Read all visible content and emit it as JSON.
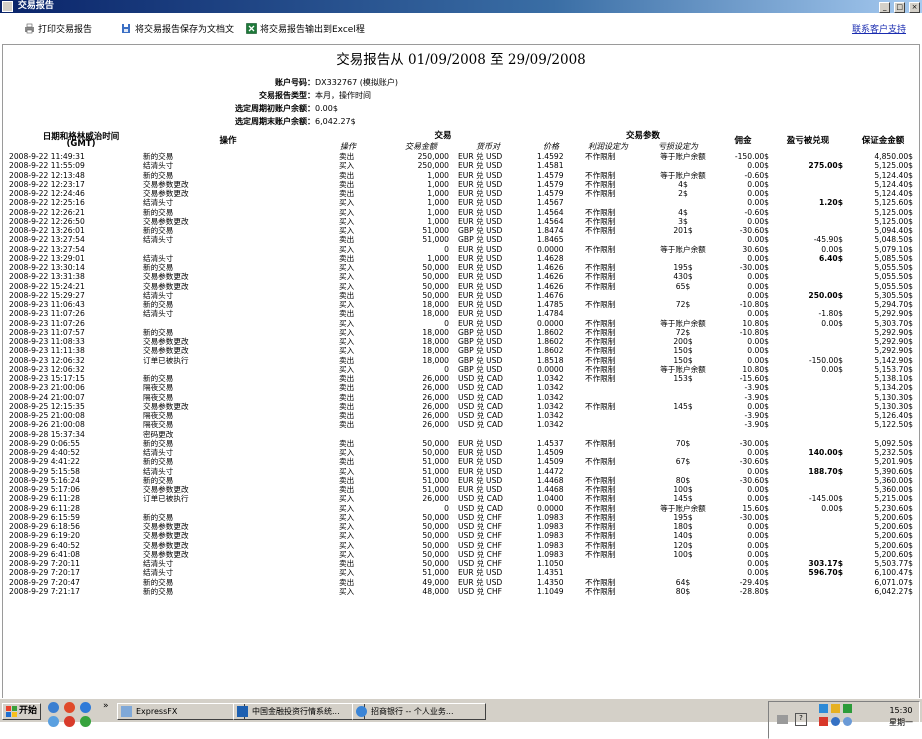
{
  "window": {
    "title": "交易报告",
    "buttons": [
      "_",
      "□",
      "×"
    ]
  },
  "toolbar": {
    "print_label": "打印交易报告",
    "save_label": "将交易报告保存为文档文",
    "excel_label": "将交易报告输出到Excel程",
    "support_link": "联系客户支持"
  },
  "report": {
    "title": "交易报告从 01/09/2008 至 29/09/2008",
    "meta": [
      {
        "label": "账户号码：",
        "value": "DX332767 (模拟账户)"
      },
      {
        "label": "交易报告类型：",
        "value": "本月，操作时间"
      },
      {
        "label": "选定周期初账户余额：",
        "value": "0.00$"
      },
      {
        "label": "选定周期末账户余额：",
        "value": "6,042.27$"
      }
    ],
    "headers": {
      "date": "日期和格林威治时间",
      "date_sub": "(GMT)",
      "operation": "操作",
      "trade": "交易",
      "trade_params": "交易参数",
      "commission": "佣金",
      "pl": "盈亏被兑现",
      "margin": "保证金金额"
    },
    "subheaders": {
      "action": "操作",
      "amount": "交易金额",
      "pair": "货币对",
      "price": "价格",
      "stop": "利润设定为",
      "limit": "亏损设定为"
    },
    "rows": [
      [
        "2008-9-22 11:49:31",
        "新的交易",
        "卖出",
        "250,000",
        "EUR 兑 USD",
        "1.4592",
        "不作限制",
        "等于账户余额",
        "-150.00$",
        "",
        "4,850.00$"
      ],
      [
        "2008-9-22 11:55:09",
        "结清头寸",
        "买入",
        "250,000",
        "EUR 兑 USD",
        "1.4581",
        "",
        "",
        "0.00$",
        "275.00$",
        "5,125.00$"
      ],
      [
        "2008-9-22 12:13:48",
        "新的交易",
        "卖出",
        "1,000",
        "EUR 兑 USD",
        "1.4579",
        "不作限制",
        "等于账户余额",
        "-0.60$",
        "",
        "5,124.40$"
      ],
      [
        "2008-9-22 12:23:17",
        "交易参数更改",
        "卖出",
        "1,000",
        "EUR 兑 USD",
        "1.4579",
        "不作限制",
        "4$",
        "0.00$",
        "",
        "5,124.40$"
      ],
      [
        "2008-9-22 12:24:46",
        "交易参数更改",
        "卖出",
        "1,000",
        "EUR 兑 USD",
        "1.4579",
        "不作限制",
        "2$",
        "0.00$",
        "",
        "5,124.40$"
      ],
      [
        "2008-9-22 12:25:16",
        "结清头寸",
        "买入",
        "1,000",
        "EUR 兑 USD",
        "1.4567",
        "",
        "",
        "0.00$",
        "1.20$",
        "5,125.60$"
      ],
      [
        "2008-9-22 12:26:21",
        "新的交易",
        "买入",
        "1,000",
        "EUR 兑 USD",
        "1.4564",
        "不作限制",
        "4$",
        "-0.60$",
        "",
        "5,125.00$"
      ],
      [
        "2008-9-22 12:26:50",
        "交易参数更改",
        "买入",
        "1,000",
        "EUR 兑 USD",
        "1.4564",
        "不作限制",
        "3$",
        "0.00$",
        "",
        "5,125.00$"
      ],
      [
        "2008-9-22 13:26:01",
        "新的交易",
        "买入",
        "51,000",
        "GBP 兑 USD",
        "1.8474",
        "不作限制",
        "201$",
        "-30.60$",
        "",
        "5,094.40$"
      ],
      [
        "2008-9-22 13:27:54",
        "结清头寸",
        "卖出",
        "51,000",
        "GBP 兑 USD",
        "1.8465",
        "",
        "",
        "0.00$",
        "-45.90$",
        "5,048.50$"
      ],
      [
        "2008-9-22 13:27:54",
        "",
        "买入",
        "0",
        "EUR 兑 USD",
        "0.0000",
        "不作限制",
        "等于账户余额",
        "30.60$",
        "0.00$",
        "5,079.10$"
      ],
      [
        "2008-9-22 13:29:01",
        "结清头寸",
        "卖出",
        "1,000",
        "EUR 兑 USD",
        "1.4628",
        "",
        "",
        "0.00$",
        "6.40$",
        "5,085.50$"
      ],
      [
        "2008-9-22 13:30:14",
        "新的交易",
        "买入",
        "50,000",
        "EUR 兑 USD",
        "1.4626",
        "不作限制",
        "195$",
        "-30.00$",
        "",
        "5,055.50$"
      ],
      [
        "2008-9-22 13:31:38",
        "交易参数更改",
        "买入",
        "50,000",
        "EUR 兑 USD",
        "1.4626",
        "不作限制",
        "430$",
        "0.00$",
        "",
        "5,055.50$"
      ],
      [
        "2008-9-22 15:24:21",
        "交易参数更改",
        "买入",
        "50,000",
        "EUR 兑 USD",
        "1.4626",
        "不作限制",
        "65$",
        "0.00$",
        "",
        "5,055.50$"
      ],
      [
        "2008-9-22 15:29:27",
        "结清头寸",
        "卖出",
        "50,000",
        "EUR 兑 USD",
        "1.4676",
        "",
        "",
        "0.00$",
        "250.00$",
        "5,305.50$"
      ],
      [
        "2008-9-23 11:06:43",
        "新的交易",
        "买入",
        "18,000",
        "EUR 兑 USD",
        "1.4785",
        "不作限制",
        "72$",
        "-10.80$",
        "",
        "5,294.70$"
      ],
      [
        "2008-9-23 11:07:26",
        "结清头寸",
        "卖出",
        "18,000",
        "EUR 兑 USD",
        "1.4784",
        "",
        "",
        "0.00$",
        "-1.80$",
        "5,292.90$"
      ],
      [
        "2008-9-23 11:07:26",
        "",
        "买入",
        "0",
        "EUR 兑 USD",
        "0.0000",
        "不作限制",
        "等于账户余额",
        "10.80$",
        "0.00$",
        "5,303.70$"
      ],
      [
        "2008-9-23 11:07:57",
        "新的交易",
        "买入",
        "18,000",
        "GBP 兑 USD",
        "1.8602",
        "不作限制",
        "72$",
        "-10.80$",
        "",
        "5,292.90$"
      ],
      [
        "2008-9-23 11:08:33",
        "交易参数更改",
        "买入",
        "18,000",
        "GBP 兑 USD",
        "1.8602",
        "不作限制",
        "200$",
        "0.00$",
        "",
        "5,292.90$"
      ],
      [
        "2008-9-23 11:11:38",
        "交易参数更改",
        "买入",
        "18,000",
        "GBP 兑 USD",
        "1.8602",
        "不作限制",
        "150$",
        "0.00$",
        "",
        "5,292.90$"
      ],
      [
        "2008-9-23 12:06:32",
        "订单已被执行",
        "卖出",
        "18,000",
        "GBP 兑 USD",
        "1.8518",
        "不作限制",
        "150$",
        "0.00$",
        "-150.00$",
        "5,142.90$"
      ],
      [
        "2008-9-23 12:06:32",
        "",
        "买入",
        "0",
        "GBP 兑 USD",
        "0.0000",
        "不作限制",
        "等于账户余额",
        "10.80$",
        "0.00$",
        "5,153.70$"
      ],
      [
        "2008-9-23 15:17:15",
        "新的交易",
        "卖出",
        "26,000",
        "USD 兑 CAD",
        "1.0342",
        "不作限制",
        "153$",
        "-15.60$",
        "",
        "5,138.10$"
      ],
      [
        "2008-9-23 21:00:06",
        "隔夜交易",
        "卖出",
        "26,000",
        "USD 兑 CAD",
        "1.0342",
        "",
        "",
        "-3.90$",
        "",
        "5,134.20$"
      ],
      [
        "2008-9-24 21:00:07",
        "隔夜交易",
        "卖出",
        "26,000",
        "USD 兑 CAD",
        "1.0342",
        "",
        "",
        "-3.90$",
        "",
        "5,130.30$"
      ],
      [
        "2008-9-25 12:15:35",
        "交易参数更改",
        "卖出",
        "26,000",
        "USD 兑 CAD",
        "1.0342",
        "不作限制",
        "145$",
        "0.00$",
        "",
        "5,130.30$"
      ],
      [
        "2008-9-25 21:00:08",
        "隔夜交易",
        "卖出",
        "26,000",
        "USD 兑 CAD",
        "1.0342",
        "",
        "",
        "-3.90$",
        "",
        "5,126.40$"
      ],
      [
        "2008-9-26 21:00:08",
        "隔夜交易",
        "卖出",
        "26,000",
        "USD 兑 CAD",
        "1.0342",
        "",
        "",
        "-3.90$",
        "",
        "5,122.50$"
      ],
      [
        "2008-9-28 15:37:34",
        "密码更改",
        "",
        "",
        "",
        "",
        "",
        "",
        "",
        "",
        ""
      ],
      [
        "2008-9-29 0:06:55",
        "新的交易",
        "卖出",
        "50,000",
        "EUR 兑 USD",
        "1.4537",
        "不作限制",
        "70$",
        "-30.00$",
        "",
        "5,092.50$"
      ],
      [
        "2008-9-29 4:40:52",
        "结清头寸",
        "买入",
        "50,000",
        "EUR 兑 USD",
        "1.4509",
        "",
        "",
        "0.00$",
        "140.00$",
        "5,232.50$"
      ],
      [
        "2008-9-29 4:41:22",
        "新的交易",
        "卖出",
        "51,000",
        "EUR 兑 USD",
        "1.4509",
        "不作限制",
        "67$",
        "-30.60$",
        "",
        "5,201.90$"
      ],
      [
        "2008-9-29 5:15:58",
        "结清头寸",
        "买入",
        "51,000",
        "EUR 兑 USD",
        "1.4472",
        "",
        "",
        "0.00$",
        "188.70$",
        "5,390.60$"
      ],
      [
        "2008-9-29 5:16:24",
        "新的交易",
        "卖出",
        "51,000",
        "EUR 兑 USD",
        "1.4468",
        "不作限制",
        "80$",
        "-30.60$",
        "",
        "5,360.00$"
      ],
      [
        "2008-9-29 5:17:06",
        "交易参数更改",
        "卖出",
        "51,000",
        "EUR 兑 USD",
        "1.4468",
        "不作限制",
        "100$",
        "0.00$",
        "",
        "5,360.00$"
      ],
      [
        "2008-9-29 6:11:28",
        "订单已被执行",
        "买入",
        "26,000",
        "USD 兑 CAD",
        "1.0400",
        "不作限制",
        "145$",
        "0.00$",
        "-145.00$",
        "5,215.00$"
      ],
      [
        "2008-9-29 6:11:28",
        "",
        "买入",
        "0",
        "USD 兑 CAD",
        "0.0000",
        "不作限制",
        "等于账户余额",
        "15.60$",
        "0.00$",
        "5,230.60$"
      ],
      [
        "2008-9-29 6:15:59",
        "新的交易",
        "买入",
        "50,000",
        "USD 兑 CHF",
        "1.0983",
        "不作限制",
        "195$",
        "-30.00$",
        "",
        "5,200.60$"
      ],
      [
        "2008-9-29 6:18:56",
        "交易参数更改",
        "买入",
        "50,000",
        "USD 兑 CHF",
        "1.0983",
        "不作限制",
        "180$",
        "0.00$",
        "",
        "5,200.60$"
      ],
      [
        "2008-9-29 6:19:20",
        "交易参数更改",
        "买入",
        "50,000",
        "USD 兑 CHF",
        "1.0983",
        "不作限制",
        "140$",
        "0.00$",
        "",
        "5,200.60$"
      ],
      [
        "2008-9-29 6:40:52",
        "交易参数更改",
        "买入",
        "50,000",
        "USD 兑 CHF",
        "1.0983",
        "不作限制",
        "120$",
        "0.00$",
        "",
        "5,200.60$"
      ],
      [
        "2008-9-29 6:41:08",
        "交易参数更改",
        "买入",
        "50,000",
        "USD 兑 CHF",
        "1.0983",
        "不作限制",
        "100$",
        "0.00$",
        "",
        "5,200.60$"
      ],
      [
        "2008-9-29 7:20:11",
        "结清头寸",
        "卖出",
        "50,000",
        "USD 兑 CHF",
        "1.1050",
        "",
        "",
        "0.00$",
        "303.17$",
        "5,503.77$"
      ],
      [
        "2008-9-29 7:20:17",
        "结清头寸",
        "买入",
        "51,000",
        "EUR 兑 USD",
        "1.4351",
        "",
        "",
        "0.00$",
        "596.70$",
        "6,100.47$"
      ],
      [
        "2008-9-29 7:20:47",
        "新的交易",
        "卖出",
        "49,000",
        "EUR 兑 USD",
        "1.4350",
        "不作限制",
        "64$",
        "-29.40$",
        "",
        "6,071.07$"
      ],
      [
        "2008-9-29 7:21:17",
        "新的交易",
        "买入",
        "48,000",
        "USD 兑 CHF",
        "1.1049",
        "不作限制",
        "80$",
        "-28.80$",
        "",
        "6,042.27$"
      ]
    ],
    "bold_pl": [
      "275.00$",
      "1.20$",
      "6.40$",
      "250.00$",
      "140.00$",
      "188.70$",
      "303.17$",
      "596.70$"
    ]
  },
  "taskbar": {
    "start_label": "开始",
    "more": "»",
    "tasks": [
      "ExpressFX",
      "中国金融投资行情系统...",
      "招商银行 -- 个人业务..."
    ],
    "clock": "15:30",
    "weekday": "星期一"
  },
  "colors": {
    "titlebar": "#0a246a",
    "link": "#1a2cb0",
    "chrome": "#d4d0c8"
  }
}
